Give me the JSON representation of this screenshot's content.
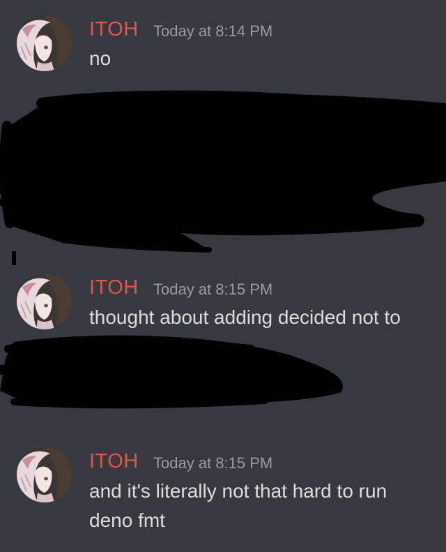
{
  "messages": [
    {
      "username": "ITOH",
      "timestamp": "Today at 8:14 PM",
      "lines": [
        "no"
      ]
    },
    {
      "username": "ITOH",
      "timestamp": "Today at 8:15 PM",
      "lines": [
        "thought about adding decided not to"
      ]
    },
    {
      "username": "ITOH",
      "timestamp": "Today at 8:15 PM",
      "lines": [
        "and it's literally not that hard to run",
        "deno fmt"
      ]
    }
  ],
  "colors": {
    "background": "#36393f",
    "username": "#e0564f",
    "timestamp": "#9a9ca1",
    "text": "#dcddde",
    "redaction": "#000000"
  },
  "icons": {
    "avatar": "anime-avatar-icon"
  }
}
